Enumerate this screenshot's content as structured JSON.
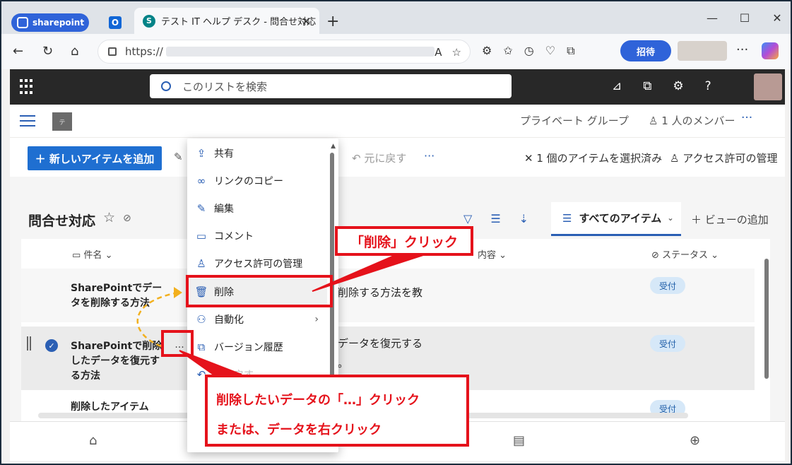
{
  "browser": {
    "profile_label": "sharepoint",
    "outlook_glyph": "O",
    "tab_title": "テスト IT ヘルプ デスク - 問合せ対応",
    "url_prefix": "https://",
    "invite_label": "招待"
  },
  "suite": {
    "search_placeholder": "このリストを検索"
  },
  "site": {
    "logo_text": "テ",
    "group_label": "プライベート グループ",
    "members_label": "1 人のメンバー"
  },
  "command_bar": {
    "new_item_label": "＋  新しいアイテムを追加",
    "undo_label": "元に戻す",
    "selected_label": "1 個のアイテムを選択済み",
    "access_label": "アクセス許可の管理"
  },
  "list": {
    "title": "問合せ対応",
    "view_label": "すべてのアイテム",
    "add_view_label": "＋ ビューの追加",
    "columns": {
      "name": "件名",
      "content": "内容",
      "status": "ステータス"
    },
    "rows": [
      {
        "title": "SharePointでデータを削除する方法",
        "desc": "削除する方法を教",
        "status": "受付"
      },
      {
        "title": "SharePointで削除したデータを復元する方法",
        "desc_line1": "データを復元する",
        "desc_line2": "。",
        "status": "受付"
      },
      {
        "title": "削除したアイテム",
        "status": "受付"
      }
    ]
  },
  "context_menu": {
    "items": [
      {
        "label": "共有",
        "icon": "share-icon"
      },
      {
        "label": "リンクのコピー",
        "icon": "link-icon"
      },
      {
        "label": "編集",
        "icon": "pencil-icon"
      },
      {
        "label": "コメント",
        "icon": "comment-icon"
      },
      {
        "label": "アクセス許可の管理",
        "icon": "person-icon"
      },
      {
        "label": "削除",
        "icon": "trash-icon"
      },
      {
        "label": "自動化",
        "icon": "automate-icon"
      },
      {
        "label": "バージョン履歴",
        "icon": "history-icon"
      },
      {
        "label": "元に戻す",
        "icon": "undo-icon"
      }
    ]
  },
  "annotations": {
    "delete_callout": "「削除」クリック",
    "dots_callout_line1": "削除したいデータの「…」クリック",
    "dots_callout_line2": "または、データを右クリック"
  },
  "colors": {
    "accent": "#2b5fb4",
    "annotation_red": "#e5121b",
    "highlight_yellow": "#f2b01e",
    "suite_bar": "#282828"
  }
}
